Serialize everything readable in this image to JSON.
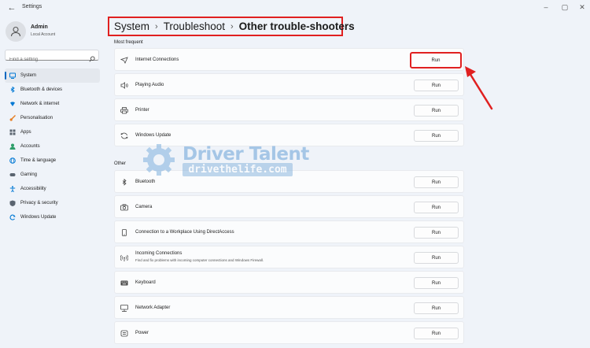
{
  "window": {
    "title": "Settings",
    "controls": [
      "minimize",
      "maximize",
      "close"
    ]
  },
  "profile": {
    "name": "Admin",
    "account_type": "Local Account"
  },
  "search": {
    "placeholder": "Find a setting"
  },
  "nav": {
    "items": [
      {
        "label": "System",
        "icon": "display-icon",
        "color": "#0078d4",
        "active": true
      },
      {
        "label": "Bluetooth & devices",
        "icon": "bluetooth-icon",
        "color": "#0078d4",
        "active": false
      },
      {
        "label": "Network & internet",
        "icon": "wifi-icon",
        "color": "#0078d4",
        "active": false
      },
      {
        "label": "Personalisation",
        "icon": "brush-icon",
        "color": "#e67e22",
        "active": false
      },
      {
        "label": "Apps",
        "icon": "apps-icon",
        "color": "#5a6470",
        "active": false
      },
      {
        "label": "Accounts",
        "icon": "person-icon",
        "color": "#2e9e6a",
        "active": false
      },
      {
        "label": "Time & language",
        "icon": "globe-icon",
        "color": "#0078d4",
        "active": false
      },
      {
        "label": "Gaming",
        "icon": "gamepad-icon",
        "color": "#5a6470",
        "active": false
      },
      {
        "label": "Accessibility",
        "icon": "accessibility-icon",
        "color": "#0078d4",
        "active": false
      },
      {
        "label": "Privacy & security",
        "icon": "shield-icon",
        "color": "#5a6470",
        "active": false
      },
      {
        "label": "Windows Update",
        "icon": "update-icon",
        "color": "#0078d4",
        "active": false
      }
    ]
  },
  "breadcrumb": {
    "parts": [
      "System",
      "Troubleshoot"
    ],
    "current": "Other trouble-shooters"
  },
  "sections": {
    "most_frequent": "Most frequent",
    "other": "Other"
  },
  "troubleshooters": {
    "most_frequent": [
      {
        "title": "Internet Connections",
        "icon": "network-icon",
        "button": "Run",
        "highlighted": true
      },
      {
        "title": "Playing Audio",
        "icon": "speaker-icon",
        "button": "Run"
      },
      {
        "title": "Printer",
        "icon": "printer-icon",
        "button": "Run"
      },
      {
        "title": "Windows Update",
        "icon": "sync-icon",
        "button": "Run"
      }
    ],
    "other": [
      {
        "title": "Bluetooth",
        "icon": "bluetooth-icon",
        "button": "Run"
      },
      {
        "title": "Camera",
        "icon": "camera-icon",
        "button": "Run"
      },
      {
        "title": "Connection to a Workplace Using DirectAccess",
        "icon": "phone-icon",
        "button": "Run"
      },
      {
        "title": "Incoming Connections",
        "description": "Find and fix problems with incoming computer connections and Windows Firewall.",
        "icon": "signal-icon",
        "button": "Run"
      },
      {
        "title": "Keyboard",
        "icon": "keyboard-icon",
        "button": "Run"
      },
      {
        "title": "Network Adapter",
        "icon": "monitor-network-icon",
        "button": "Run"
      },
      {
        "title": "Power",
        "icon": "power-icon",
        "button": "Run"
      }
    ]
  },
  "annotation": {
    "color": "#e02020"
  },
  "watermark": {
    "brand": "Driver Talent",
    "url": "drivethelife.com"
  }
}
